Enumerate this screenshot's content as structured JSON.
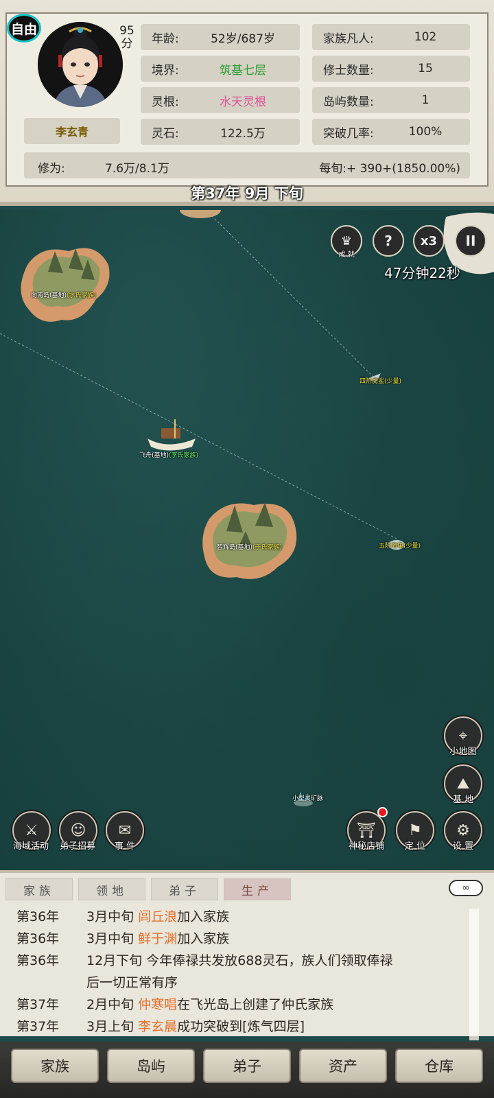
{
  "header": {
    "status_badge": "自由",
    "score_value": "95",
    "score_unit": "分",
    "character_name": "李玄青",
    "stats_left": [
      {
        "label": "年龄:",
        "value": "52岁/687岁",
        "color": "#2b2520"
      },
      {
        "label": "境界:",
        "value": "筑基七层",
        "color": "#2f9e33"
      },
      {
        "label": "灵根:",
        "value": "水天灵根",
        "color": "#e0559a"
      },
      {
        "label": "灵石:",
        "value": "122.5万",
        "color": "#2b2520"
      }
    ],
    "stats_right": [
      {
        "label": "家族凡人:",
        "value": "102"
      },
      {
        "label": "修士数量:",
        "value": "15"
      },
      {
        "label": "岛屿数量:",
        "value": "1"
      },
      {
        "label": "突破几率:",
        "value": "100%"
      }
    ],
    "cultivation_label": "修为:",
    "cultivation_value": "7.6万/8.1万",
    "per_period": "每旬:+ 390+(1850.00%)"
  },
  "date_title": "第37年 9月 下旬",
  "map": {
    "islands": [
      {
        "name": "向南岛(基地)",
        "family": "(水氏家族)"
      },
      {
        "name": "智辉岛(基地)",
        "family": "(于氏家族)"
      }
    ],
    "ship": {
      "name": "飞舟(基地)",
      "family": "(李氏家族)"
    },
    "monsters": [
      "四阶虎鲨(少量)",
      "五阶海龟(少量)"
    ],
    "mine": "小型灵矿脉",
    "top_buttons": {
      "achievement": "成 就",
      "help": "?",
      "speed": "x3",
      "pause": "II"
    },
    "timer": "47分钟22秒",
    "right_tools": {
      "minimap": "小地图",
      "base": "基 地"
    },
    "bottom_tools": {
      "sea_activity": "海域活动",
      "recruit": "弟子招募",
      "events": "事 件",
      "shop": "神秘店铺",
      "locate": "定 位",
      "settings": "设 置"
    }
  },
  "log": {
    "tabs": [
      "家族",
      "领地",
      "弟子",
      "生产"
    ],
    "active_tab": "生产",
    "entries": [
      {
        "year": "第36年",
        "pre": "3月中旬 ",
        "name": "闾丘浪",
        "post": "加入家族"
      },
      {
        "year": "第36年",
        "pre": "3月中旬 ",
        "name": "鲜于渊",
        "post": "加入家族"
      },
      {
        "year": "第36年",
        "pre": "12月下旬 今年俸禄共发放688灵石，族人们领取俸禄",
        "name": "",
        "post": ""
      },
      {
        "year": "",
        "pre": "后一切正常有序",
        "name": "",
        "post": ""
      },
      {
        "year": "第37年",
        "pre": "2月中旬 ",
        "name": "仲寒唱",
        "post": "在飞光岛上创建了仲氏家族"
      },
      {
        "year": "第37年",
        "pre": "3月上旬 ",
        "name": "李玄晨",
        "post": "成功突破到[炼气四层]"
      }
    ]
  },
  "bottom_nav": [
    "家族",
    "岛屿",
    "弟子",
    "资产",
    "仓库"
  ]
}
